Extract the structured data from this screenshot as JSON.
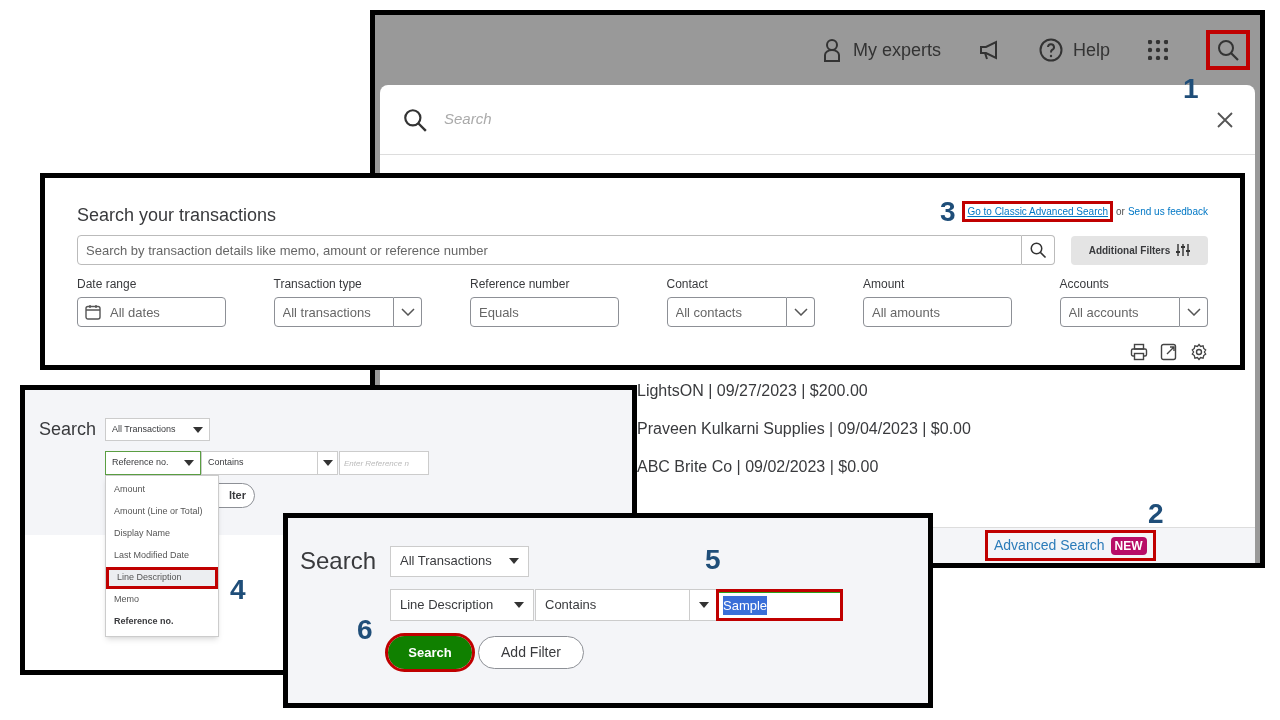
{
  "top_bar": {
    "experts": "My experts",
    "help": "Help",
    "search_highlighted": true,
    "step": "1"
  },
  "search_popup": {
    "placeholder": "Search",
    "results": [
      "LightsON | 09/27/2023 | $200.00",
      "Praveen Kulkarni Supplies | 09/04/2023 | $0.00",
      "ABC Brite Co | 09/02/2023 | $0.00"
    ],
    "advanced_link": "Advanced Search",
    "badge": "NEW",
    "advanced_highlighted": true,
    "step": "2"
  },
  "transactions_panel": {
    "title": "Search your transactions",
    "classic_link": "Go to Classic Advanced Search",
    "classic_highlighted": true,
    "step": "3",
    "or": "or",
    "feedback_link": "Send us feedback",
    "search_placeholder": "Search by transaction details like memo, amount or reference number",
    "additional_filters": "Additional Filters",
    "filters": [
      {
        "label": "Date range",
        "kind": "date",
        "placeholder": "All dates"
      },
      {
        "label": "Transaction type",
        "kind": "select",
        "placeholder": "All transactions"
      },
      {
        "label": "Reference number",
        "kind": "input",
        "placeholder": "Equals"
      },
      {
        "label": "Contact",
        "kind": "select",
        "placeholder": "All contacts"
      },
      {
        "label": "Amount",
        "kind": "input",
        "placeholder": "All amounts"
      },
      {
        "label": "Accounts",
        "kind": "select",
        "placeholder": "All accounts"
      }
    ]
  },
  "classic_search": {
    "title": "Search",
    "type": "All Transactions",
    "field": "Reference no.",
    "operator": "Contains",
    "value_placeholder": "Enter Reference n",
    "hidden_button": "lter",
    "menu": [
      {
        "label": "Amount",
        "selected": false,
        "current": false
      },
      {
        "label": "Amount (Line or Total)",
        "selected": false,
        "current": false
      },
      {
        "label": "Display Name",
        "selected": false,
        "current": false
      },
      {
        "label": "Last Modified Date",
        "selected": false,
        "current": false
      },
      {
        "label": "Line Description",
        "selected": true,
        "current": false
      },
      {
        "label": "Memo",
        "selected": false,
        "current": false
      },
      {
        "label": "Reference no.",
        "selected": false,
        "current": true
      }
    ],
    "step": "4"
  },
  "filled_search": {
    "title": "Search",
    "type": "All Transactions",
    "field": "Line Description",
    "operator": "Contains",
    "value": "Sample",
    "value_highlighted": true,
    "value_step": "5",
    "search_button": "Search",
    "search_highlighted": true,
    "search_step": "6",
    "add_filter": "Add Filter"
  }
}
